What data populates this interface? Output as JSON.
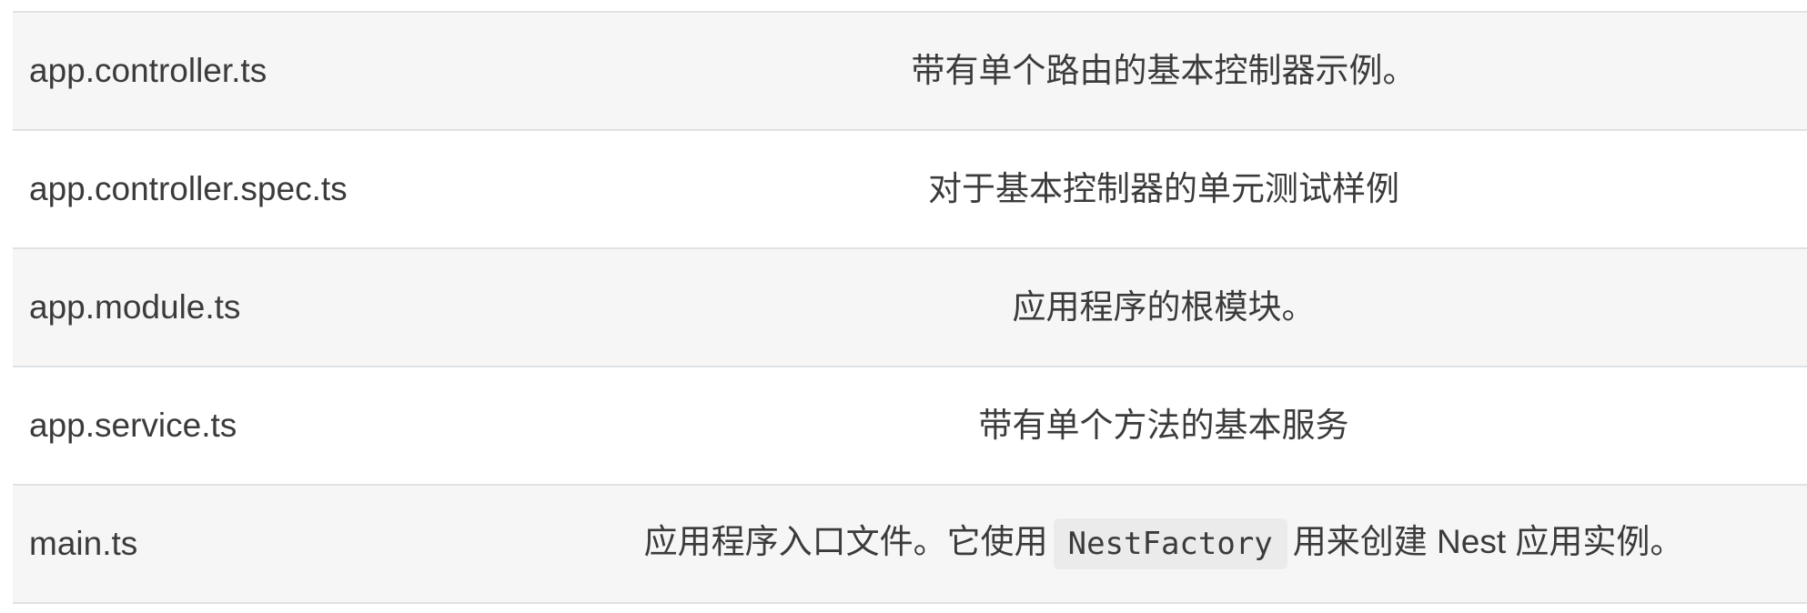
{
  "rows": [
    {
      "file": "app.controller.ts",
      "description": "带有单个路由的基本控制器示例。"
    },
    {
      "file": "app.controller.spec.ts",
      "description": "对于基本控制器的单元测试样例"
    },
    {
      "file": "app.module.ts",
      "description": "应用程序的根模块。"
    },
    {
      "file": "app.service.ts",
      "description": "带有单个方法的基本服务"
    },
    {
      "file": "main.ts",
      "description_before": "应用程序入口文件。它使用",
      "description_code": "NestFactory",
      "description_after": "用来创建 Nest 应用实例。"
    }
  ]
}
